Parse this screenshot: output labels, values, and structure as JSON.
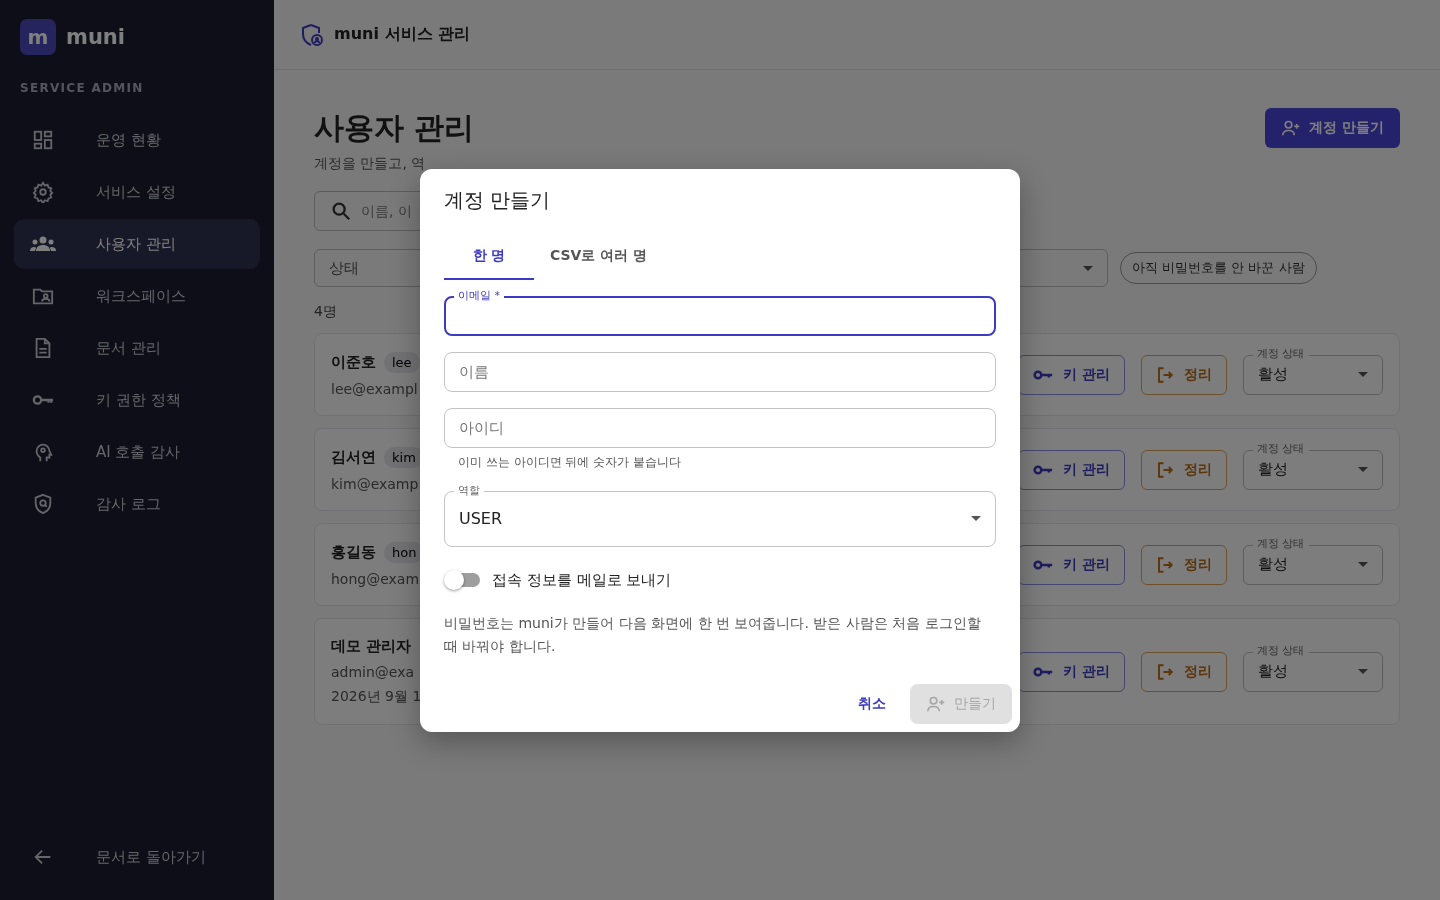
{
  "sidebar": {
    "logo_mark": "m",
    "brand": "muni",
    "section_label": "SERVICE ADMIN",
    "items": [
      {
        "label": "운영 현황",
        "selected": false
      },
      {
        "label": "서비스 설정",
        "selected": false
      },
      {
        "label": "사용자 관리",
        "selected": true
      },
      {
        "label": "워크스페이스",
        "selected": false
      },
      {
        "label": "문서 관리",
        "selected": false
      },
      {
        "label": "키 권한 정책",
        "selected": false
      },
      {
        "label": "AI 호출 감사",
        "selected": false
      },
      {
        "label": "감사 로그",
        "selected": false
      }
    ],
    "footer_link": "문서로 돌아가기"
  },
  "header": {
    "title": "muni 서비스 관리"
  },
  "page": {
    "title": "사용자 관리",
    "subtitle": "계정을 만들고, 역",
    "create_button": "계정 만들기",
    "search": {
      "placeholder": "이름, 이"
    },
    "status_filter": "상태",
    "chip": "아직 비밀번호를 안 바꾼 사람",
    "count": "4명",
    "users": [
      {
        "name": "이준호",
        "badge": "lee",
        "email": "lee@exampl",
        "key_button": "키 관리",
        "cleanup_button": "정리",
        "status_label": "계정 상태",
        "status": "활성"
      },
      {
        "name": "김서연",
        "badge": "kim",
        "email": "kim@examp",
        "key_button": "키 관리",
        "cleanup_button": "정리",
        "status_label": "계정 상태",
        "status": "활성"
      },
      {
        "name": "홍길동",
        "badge": "hon",
        "email": "hong@exam",
        "key_button": "키 관리",
        "cleanup_button": "정리",
        "status_label": "계정 상태",
        "status": "활성"
      },
      {
        "name": "데모 관리자",
        "email": "admin@exa",
        "date": "2026년 9월 1",
        "key_button": "키 관리",
        "cleanup_button": "정리",
        "status_label": "계정 상태",
        "status": "활성"
      }
    ]
  },
  "dialog": {
    "title": "계정 만들기",
    "tabs": [
      {
        "label": "한 명",
        "selected": true
      },
      {
        "label": "CSV로 여러 명",
        "selected": false
      }
    ],
    "fields": [
      {
        "kind": "text",
        "label": "이메일 *",
        "focused": true
      },
      {
        "kind": "text",
        "placeholder": "이름",
        "focused": false
      },
      {
        "kind": "text",
        "placeholder": "아이디",
        "helper": "이미 쓰는 아이디면 뒤에 숫자가 붙습니다",
        "focused": false
      },
      {
        "kind": "select",
        "label": "역할",
        "value": "USER",
        "focused": false
      }
    ],
    "switch": {
      "label": "접속 정보를 메일로 보내기",
      "on": false
    },
    "note": "비밀번호는 muni가 만들어 다음 화면에 한 번 보여줍니다. 받은 사람은 처음 로그인할 때 바꿔야 합니다.",
    "cancel_button": "취소",
    "submit_button": {
      "label": "만들기",
      "disabled": true
    }
  }
}
